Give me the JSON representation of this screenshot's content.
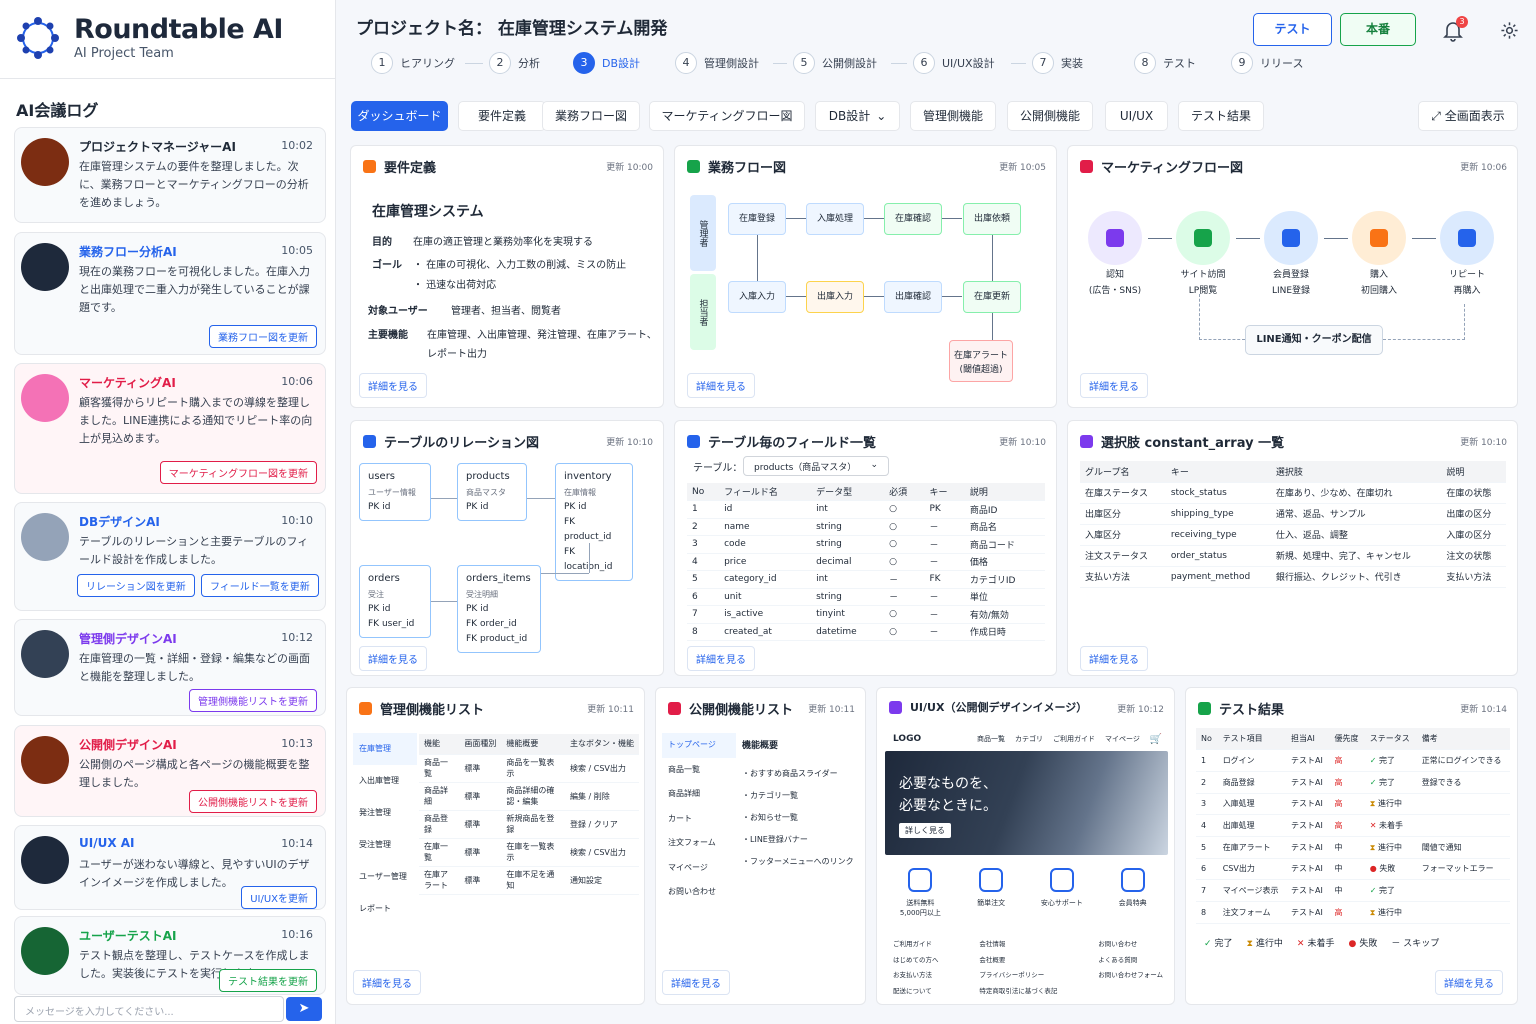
{
  "brand": {
    "title": "Roundtable AI",
    "subtitle": "AI Project Team"
  },
  "log": {
    "title": "AI会議ログ",
    "input_placeholder": "メッセージを入力してください...",
    "send": "➤",
    "messages": [
      {
        "name": "プロジェクトマネージャーAI",
        "time": "10:02",
        "text": "在庫管理システムの要件を整理しました。次に、業務フローとマーケティングフローの分析を進めましょう。"
      },
      {
        "name": "業務フロー分析AI",
        "time": "10:05",
        "text": "現在の業務フローを可視化しました。在庫入力と出庫処理で二重入力が発生していることが課題です。",
        "btn": "業務フロー図を更新"
      },
      {
        "name": "マーケティングAI",
        "time": "10:06",
        "text": "顧客獲得からリピート購入までの導線を整理しました。LINE連携による通知でリピート率の向上が見込めます。",
        "btn": "マーケティングフロー図を更新"
      },
      {
        "name": "DBデザインAI",
        "time": "10:10",
        "text": "テーブルのリレーションと主要テーブルのフィールド設計を作成しました。",
        "btn": "リレーション図を更新",
        "btn2": "フィールド一覧を更新"
      },
      {
        "name": "管理側デザインAI",
        "time": "10:12",
        "text": "在庫管理の一覧・詳細・登録・編集などの画面と機能を整理しました。",
        "btn": "管理側機能リストを更新"
      },
      {
        "name": "公開側デザインAI",
        "time": "10:13",
        "text": "公開側のページ構成と各ページの機能概要を整理しました。",
        "btn": "公開側機能リストを更新"
      },
      {
        "name": "UI/UX AI",
        "time": "10:14",
        "text": "ユーザーが迷わない導線と、見やすいUIのデザインイメージを作成しました。",
        "btn": "UI/UXを更新"
      },
      {
        "name": "ユーザーテストAI",
        "time": "10:16",
        "text": "テスト観点を整理し、テストケースを作成しました。実装後にテストを実行します。",
        "btn": "テスト結果を更新"
      }
    ]
  },
  "header": {
    "project": "プロジェクト名：  在庫管理システム開発",
    "test_btn": "テスト",
    "prod_btn": "本番",
    "badge": "3"
  },
  "steps": [
    {
      "n": "1",
      "label": "ヒアリング"
    },
    {
      "n": "2",
      "label": "分析"
    },
    {
      "n": "3",
      "label": "DB設計"
    },
    {
      "n": "4",
      "label": "管理側設計"
    },
    {
      "n": "5",
      "label": "公開側設計"
    },
    {
      "n": "6",
      "label": "UI/UX設計"
    },
    {
      "n": "7",
      "label": "実装"
    },
    {
      "n": "8",
      "label": "テスト"
    },
    {
      "n": "9",
      "label": "リリース"
    }
  ],
  "tabs": [
    "ダッシュボード",
    "要件定義",
    "業務フロー図",
    "マーケティングフロー図",
    "DB設計",
    "管理側機能",
    "公開側機能",
    "UI/UX",
    "テスト結果"
  ],
  "db_tab_caret": "⌄",
  "fullscreen": "全画面表示",
  "more": "詳細を見る",
  "req": {
    "title": "要件定義",
    "updated": "更新 10:00",
    "system": "在庫管理システム",
    "purpose_k": "目的",
    "purpose": "在庫の適正管理と業務効率化を実現する",
    "goal_k": "ゴール",
    "goal1": "・ 在庫の可視化、入力工数の削減、ミスの防止",
    "goal2": "・ 迅速な出荷対応",
    "users_k": "対象ユーザー",
    "users": "管理者、担当者、閲覧者",
    "func_k": "主要機能",
    "func": "在庫管理、入出庫管理、発注管理、在庫アラート、レポート出力"
  },
  "flow": {
    "title": "業務フロー図",
    "updated": "更新 10:05",
    "lane1": "管理者",
    "lane2": "担当者",
    "b": [
      "在庫登録",
      "入庫処理",
      "在庫確認",
      "出庫依頼",
      "入庫入力",
      "出庫入力",
      "出庫確認",
      "在庫更新",
      "在庫アラート",
      "(閾値超過)"
    ]
  },
  "mkt": {
    "title": "マーケティングフロー図",
    "updated": "更新 10:06",
    "nodes": [
      {
        "a": "認知",
        "b": "(広告・SNS)"
      },
      {
        "a": "サイト訪問",
        "b": "LP閲覧"
      },
      {
        "a": "会員登録",
        "b": "LINE登録"
      },
      {
        "a": "購入",
        "b": "初回購入"
      },
      {
        "a": "リピート",
        "b": "再購入"
      }
    ],
    "line": "LINE通知・クーポン配信"
  },
  "rel": {
    "title": "テーブルのリレーション図",
    "updated": "更新 10:10",
    "t": [
      {
        "n": "users",
        "s": "ユーザー情報",
        "f": [
          "PK  id"
        ]
      },
      {
        "n": "products",
        "s": "商品マスタ",
        "f": [
          "PK  id"
        ]
      },
      {
        "n": "inventory",
        "s": "在庫情報",
        "f": [
          "PK  id",
          "FK  product_id",
          "FK  location_id"
        ]
      },
      {
        "n": "orders",
        "s": "受注",
        "f": [
          "PK  id",
          "FK  user_id"
        ]
      },
      {
        "n": "orders_items",
        "s": "受注明細",
        "f": [
          "PK  id",
          "FK  order_id",
          "FK  product_id"
        ]
      }
    ]
  },
  "fields": {
    "title": "テーブル毎のフィールド一覧",
    "updated": "更新 10:10",
    "table_label": "テーブル：",
    "table_value": "products（商品マスタ）",
    "caret": "⌄",
    "head": [
      "No",
      "フィールド名",
      "データ型",
      "必須",
      "キー",
      "説明"
    ],
    "rows": [
      [
        "1",
        "id",
        "int",
        "○",
        "PK",
        "商品ID"
      ],
      [
        "2",
        "name",
        "string",
        "○",
        "－",
        "商品名"
      ],
      [
        "3",
        "code",
        "string",
        "○",
        "－",
        "商品コード"
      ],
      [
        "4",
        "price",
        "decimal",
        "○",
        "－",
        "価格"
      ],
      [
        "5",
        "category_id",
        "int",
        "－",
        "FK",
        "カテゴリID"
      ],
      [
        "6",
        "unit",
        "string",
        "－",
        "－",
        "単位"
      ],
      [
        "7",
        "is_active",
        "tinyint",
        "○",
        "－",
        "有効/無効"
      ],
      [
        "8",
        "created_at",
        "datetime",
        "○",
        "－",
        "作成日時"
      ]
    ]
  },
  "consts": {
    "title": "選択肢 constant_array 一覧",
    "updated": "更新 10:10",
    "head": [
      "グループ名",
      "キー",
      "選択肢",
      "説明"
    ],
    "rows": [
      [
        "在庫ステータス",
        "stock_status",
        "在庫あり、少なめ、在庫切れ",
        "在庫の状態"
      ],
      [
        "出庫区分",
        "shipping_type",
        "通常、返品、サンプル",
        "出庫の区分"
      ],
      [
        "入庫区分",
        "receiving_type",
        "仕入、返品、調整",
        "入庫の区分"
      ],
      [
        "注文ステータス",
        "order_status",
        "新規、処理中、完了、キャンセル",
        "注文の状態"
      ],
      [
        "支払い方法",
        "payment_method",
        "銀行振込、クレジット、代引き",
        "支払い方法"
      ]
    ]
  },
  "admin": {
    "title": "管理側機能リスト",
    "updated": "更新 10:11",
    "menu": [
      "在庫管理",
      "入出庫管理",
      "発注管理",
      "受注管理",
      "ユーザー管理",
      "レポート"
    ],
    "head": [
      "機能",
      "画面種別",
      "機能概要",
      "主なボタン・機能"
    ],
    "rows": [
      [
        "商品一覧",
        "標準",
        "商品を一覧表示",
        "検索 / CSV出力"
      ],
      [
        "商品詳細",
        "標準",
        "商品詳細の確認・編集",
        "編集 / 削除"
      ],
      [
        "商品登録",
        "標準",
        "新規商品を登録",
        "登録 / クリア"
      ],
      [
        "在庫一覧",
        "標準",
        "在庫を一覧表示",
        "検索 / CSV出力"
      ],
      [
        "在庫アラート",
        "標準",
        "在庫不足を通知",
        "通知設定"
      ]
    ]
  },
  "pub": {
    "title": "公開側機能リスト",
    "updated": "更新 10:11",
    "menu": [
      "トップページ",
      "商品一覧",
      "商品詳細",
      "カート",
      "注文フォーム",
      "マイページ",
      "お問い合わせ"
    ],
    "head": "機能概要",
    "items": [
      "・おすすめ商品スライダー",
      "・カテゴリ一覧",
      "・お知らせ一覧",
      "・LINE登録バナー",
      "・フッターメニューへのリンク"
    ]
  },
  "uiux": {
    "title": "UI/UX（公開側デザインイメージ）",
    "updated": "更新 10:12",
    "logo": "LOGO",
    "nav": [
      "商品一覧",
      "カテゴリ",
      "ご利用ガイド",
      "マイページ"
    ],
    "hero1": "必要なものを、",
    "hero2": "必要なときに。",
    "hero_btn": "詳しく見る",
    "feat": [
      "送料無料\n5,000円以上",
      "簡単注文",
      "安心サポート",
      "会員特典"
    ],
    "foot": [
      [
        "ご利用ガイド",
        "はじめての方へ",
        "お支払い方法",
        "配送について"
      ],
      [
        "会社情報",
        "会社概要",
        "プライバシーポリシー",
        "特定商取引法に基づく表記"
      ],
      [
        "お問い合わせ",
        "よくある質問",
        "お問い合わせフォーム"
      ]
    ]
  },
  "tests": {
    "title": "テスト結果",
    "updated": "更新 10:14",
    "head": [
      "No",
      "テスト項目",
      "担当AI",
      "優先度",
      "ステータス",
      "備考"
    ],
    "rows": [
      [
        "1",
        "ログイン",
        "テストAI",
        "高",
        "完了",
        "正常にログインできる"
      ],
      [
        "2",
        "商品登録",
        "テストAI",
        "高",
        "完了",
        "登録できる"
      ],
      [
        "3",
        "入庫処理",
        "テストAI",
        "高",
        "進行中",
        ""
      ],
      [
        "4",
        "出庫処理",
        "テストAI",
        "高",
        "未着手",
        ""
      ],
      [
        "5",
        "在庫アラート",
        "テストAI",
        "中",
        "進行中",
        "閾値で通知"
      ],
      [
        "6",
        "CSV出力",
        "テストAI",
        "中",
        "失敗",
        "フォーマットエラー"
      ],
      [
        "7",
        "マイページ表示",
        "テストAI",
        "中",
        "完了",
        ""
      ],
      [
        "8",
        "注文フォーム",
        "テストAI",
        "高",
        "進行中",
        ""
      ]
    ],
    "legend": [
      "完了",
      "進行中",
      "未着手",
      "失敗",
      "－ スキップ"
    ]
  }
}
